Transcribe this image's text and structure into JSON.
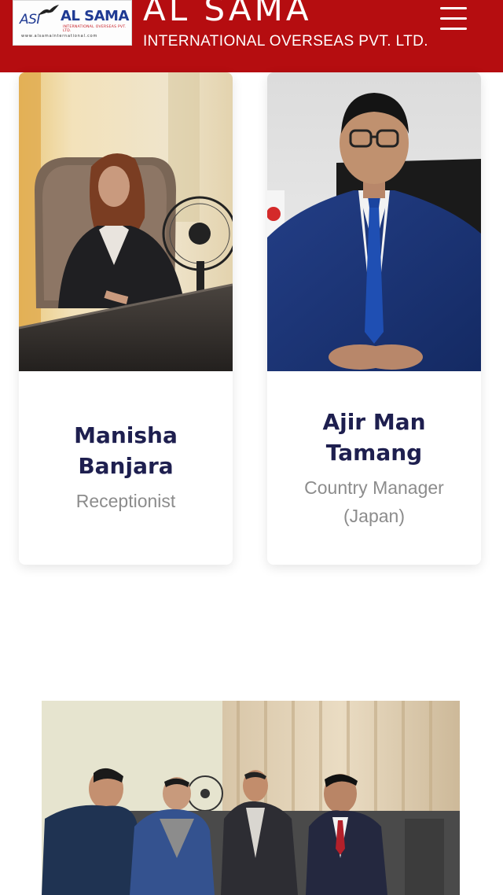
{
  "header": {
    "logo": {
      "asi_text": "ASI",
      "name_text": "AL SAMA",
      "subtitle_text": "INTERNATIONAL OVERSEAS PVT. LTD.",
      "website_text": "www.alsamainternational.com"
    },
    "title": "AL SAMA",
    "subtitle": "INTERNATIONAL OVERSEAS PVT. LTD.",
    "menu_icon": "hamburger-menu-icon",
    "background_color": "#b50d10"
  },
  "team": [
    {
      "name_line1": "Manisha",
      "name_line2": "Banjara",
      "role_line1": "Receptionist",
      "role_line2": ""
    },
    {
      "name_line1": "Ajir Man",
      "name_line2": "Tamang",
      "role_line1": "Country Manager",
      "role_line2": "(Japan)"
    }
  ],
  "colors": {
    "brand_red": "#b50d10",
    "name_navy": "#1e1f4f",
    "role_gray": "#8c8c8c"
  }
}
